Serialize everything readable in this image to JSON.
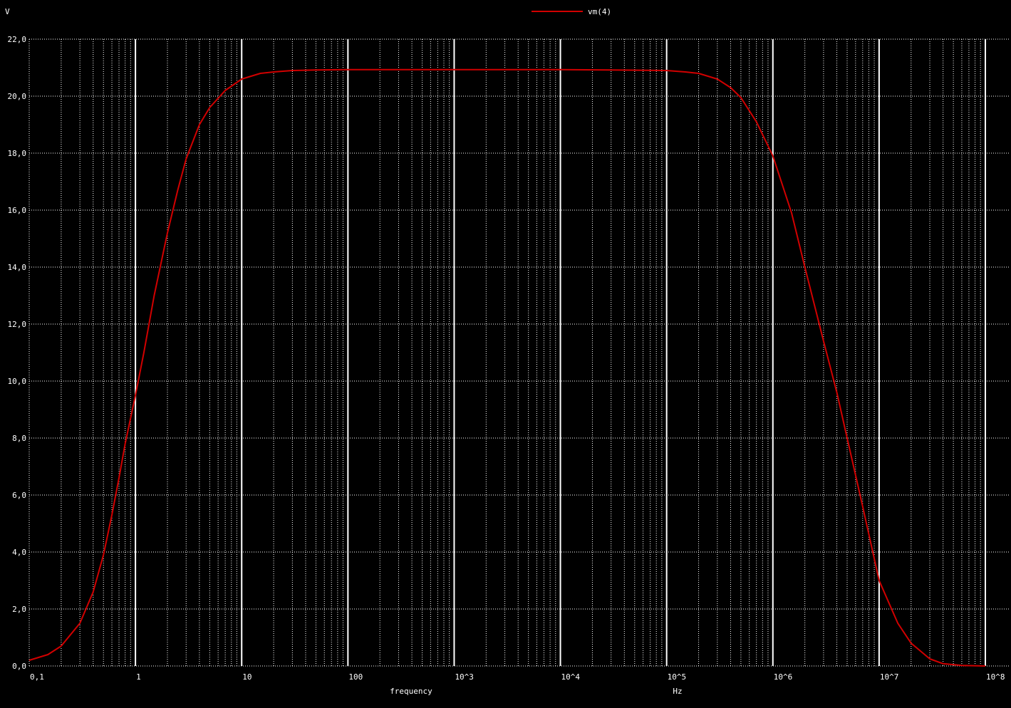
{
  "chart_data": {
    "type": "line",
    "ylabel": "V",
    "xlabel": "frequency",
    "xunit": "Hz",
    "x_scale": "log",
    "xlim": [
      0.1,
      100000000
    ],
    "ylim": [
      0,
      22
    ],
    "grid": true,
    "legend_position": "top-center",
    "colors": {
      "background": "#000000",
      "grid": "#ffffff",
      "series": "#d10000"
    },
    "x_tick_labels": [
      "0,1",
      "1",
      "10",
      "100",
      "10^3",
      "10^4",
      "10^5",
      "10^6",
      "10^7",
      "10^8"
    ],
    "y_tick_labels": [
      "0,0",
      "2,0",
      "4,0",
      "6,0",
      "8,0",
      "10,0",
      "12,0",
      "14,0",
      "16,0",
      "18,0",
      "20,0",
      "22,0"
    ],
    "series": [
      {
        "name": "vm(4)",
        "x": [
          0.1,
          0.15,
          0.2,
          0.3,
          0.4,
          0.5,
          0.6,
          0.7,
          0.8,
          1,
          1.2,
          1.5,
          2,
          2.5,
          3,
          4,
          5,
          7,
          10,
          15,
          20,
          30,
          50,
          100,
          300,
          1000,
          3000,
          10000,
          30000,
          100000,
          150000,
          200000,
          300000,
          400000,
          500000,
          700000,
          1000000,
          1500000,
          2000000,
          3000000,
          4000000,
          5000000,
          7000000,
          10000000,
          15000000,
          20000000,
          30000000,
          40000000,
          60000000,
          100000000
        ],
        "values": [
          0.2,
          0.4,
          0.7,
          1.5,
          2.6,
          3.9,
          5.3,
          6.6,
          7.8,
          9.5,
          11.0,
          13.0,
          15.2,
          16.7,
          17.8,
          19.0,
          19.6,
          20.2,
          20.6,
          20.8,
          20.85,
          20.9,
          20.92,
          20.93,
          20.93,
          20.93,
          20.93,
          20.93,
          20.92,
          20.9,
          20.85,
          20.8,
          20.6,
          20.3,
          19.95,
          19.1,
          17.9,
          15.9,
          14.0,
          11.4,
          9.6,
          8.0,
          5.6,
          3.0,
          1.5,
          0.8,
          0.25,
          0.08,
          0.02,
          0.0
        ]
      }
    ]
  }
}
